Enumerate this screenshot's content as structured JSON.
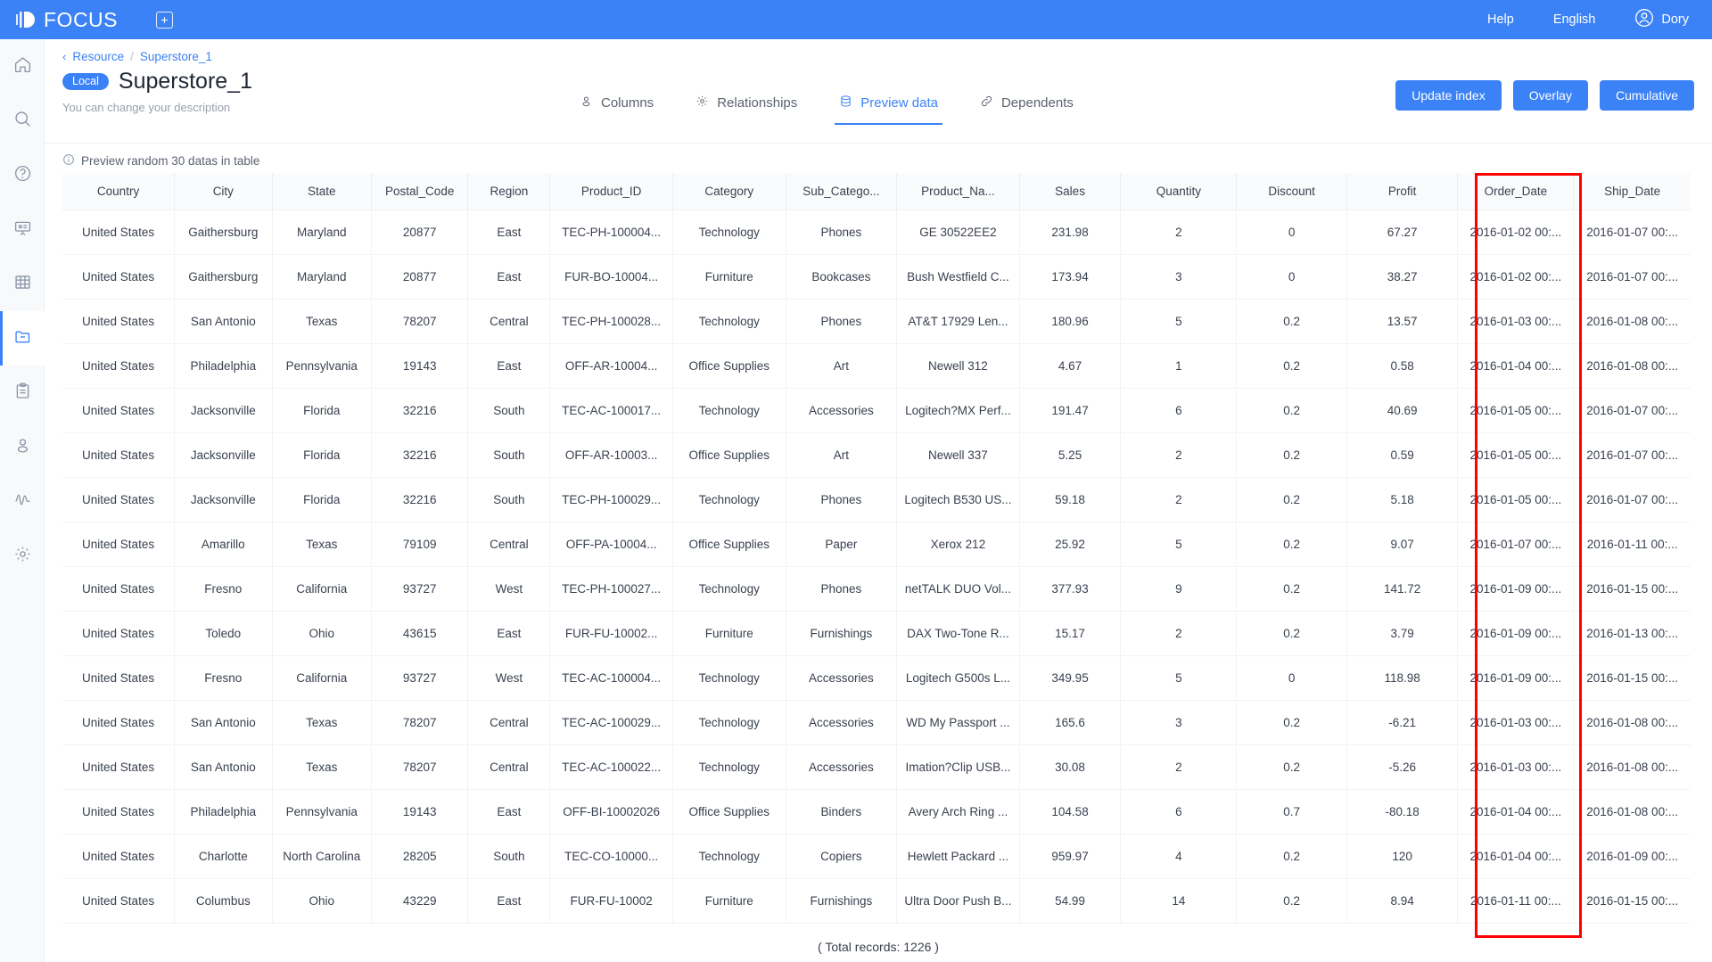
{
  "topbar": {
    "brand": "FOCUS",
    "add_icon": "plus-square-icon",
    "help": "Help",
    "language": "English",
    "user": "Dory"
  },
  "sidebar": {
    "items": [
      {
        "name": "home",
        "icon": "home-icon",
        "active": false
      },
      {
        "name": "search",
        "icon": "search-icon",
        "active": false
      },
      {
        "name": "help",
        "icon": "question-circle-icon",
        "active": false
      },
      {
        "name": "dashboard",
        "icon": "presentation-icon",
        "active": false
      },
      {
        "name": "grid",
        "icon": "table-grid-icon",
        "active": false
      },
      {
        "name": "resource",
        "icon": "folder-icon",
        "active": true
      },
      {
        "name": "reports",
        "icon": "clipboard-icon",
        "active": false
      },
      {
        "name": "users",
        "icon": "user-icon",
        "active": false
      },
      {
        "name": "monitor",
        "icon": "activity-icon",
        "active": false
      },
      {
        "name": "settings",
        "icon": "gear-icon",
        "active": false
      }
    ]
  },
  "breadcrumb": {
    "back_icon": "chevron-left-icon",
    "parent": "Resource",
    "separator": "/",
    "current": "Superstore_1"
  },
  "page_header": {
    "tag": "Local",
    "title": "Superstore_1",
    "description": "You can change your description"
  },
  "tabs": [
    {
      "label": "Columns",
      "icon": "person-icon",
      "active": false
    },
    {
      "label": "Relationships",
      "icon": "gear-icon",
      "active": false
    },
    {
      "label": "Preview data",
      "icon": "database-icon",
      "active": true
    },
    {
      "label": "Dependents",
      "icon": "link-icon",
      "active": false
    }
  ],
  "actions": [
    {
      "label": "Update index"
    },
    {
      "label": "Overlay"
    },
    {
      "label": "Cumulative"
    }
  ],
  "notice": {
    "icon": "info-circle-icon",
    "text": "Preview random 30 datas in table"
  },
  "table": {
    "columns": [
      "Country",
      "City",
      "State",
      "Postal_Code",
      "Region",
      "Product_ID",
      "Category",
      "Sub_Catego...",
      "Product_Na...",
      "Sales",
      "Quantity",
      "Discount",
      "Profit",
      "Order_Date",
      "Ship_Date"
    ],
    "highlighted_column": "Order_Date",
    "highlight_color": "#FF0000",
    "rows": [
      [
        "United States",
        "Gaithersburg",
        "Maryland",
        "20877",
        "East",
        "TEC-PH-100004...",
        "Technology",
        "Phones",
        "GE 30522EE2",
        "231.98",
        "2",
        "0",
        "67.27",
        "2016-01-02 00:...",
        "2016-01-07 00:..."
      ],
      [
        "United States",
        "Gaithersburg",
        "Maryland",
        "20877",
        "East",
        "FUR-BO-10004...",
        "Furniture",
        "Bookcases",
        "Bush Westfield C...",
        "173.94",
        "3",
        "0",
        "38.27",
        "2016-01-02 00:...",
        "2016-01-07 00:..."
      ],
      [
        "United States",
        "San Antonio",
        "Texas",
        "78207",
        "Central",
        "TEC-PH-100028...",
        "Technology",
        "Phones",
        "AT&T 17929 Len...",
        "180.96",
        "5",
        "0.2",
        "13.57",
        "2016-01-03 00:...",
        "2016-01-08 00:..."
      ],
      [
        "United States",
        "Philadelphia",
        "Pennsylvania",
        "19143",
        "East",
        "OFF-AR-10004...",
        "Office Supplies",
        "Art",
        "Newell 312",
        "4.67",
        "1",
        "0.2",
        "0.58",
        "2016-01-04 00:...",
        "2016-01-08 00:..."
      ],
      [
        "United States",
        "Jacksonville",
        "Florida",
        "32216",
        "South",
        "TEC-AC-100017...",
        "Technology",
        "Accessories",
        "Logitech?MX Perf...",
        "191.47",
        "6",
        "0.2",
        "40.69",
        "2016-01-05 00:...",
        "2016-01-07 00:..."
      ],
      [
        "United States",
        "Jacksonville",
        "Florida",
        "32216",
        "South",
        "OFF-AR-10003...",
        "Office Supplies",
        "Art",
        "Newell 337",
        "5.25",
        "2",
        "0.2",
        "0.59",
        "2016-01-05 00:...",
        "2016-01-07 00:..."
      ],
      [
        "United States",
        "Jacksonville",
        "Florida",
        "32216",
        "South",
        "TEC-PH-100029...",
        "Technology",
        "Phones",
        "Logitech B530 US...",
        "59.18",
        "2",
        "0.2",
        "5.18",
        "2016-01-05 00:...",
        "2016-01-07 00:..."
      ],
      [
        "United States",
        "Amarillo",
        "Texas",
        "79109",
        "Central",
        "OFF-PA-10004...",
        "Office Supplies",
        "Paper",
        "Xerox 212",
        "25.92",
        "5",
        "0.2",
        "9.07",
        "2016-01-07 00:...",
        "2016-01-11 00:..."
      ],
      [
        "United States",
        "Fresno",
        "California",
        "93727",
        "West",
        "TEC-PH-100027...",
        "Technology",
        "Phones",
        "netTALK DUO Vol...",
        "377.93",
        "9",
        "0.2",
        "141.72",
        "2016-01-09 00:...",
        "2016-01-15 00:..."
      ],
      [
        "United States",
        "Toledo",
        "Ohio",
        "43615",
        "East",
        "FUR-FU-10002...",
        "Furniture",
        "Furnishings",
        "DAX Two-Tone R...",
        "15.17",
        "2",
        "0.2",
        "3.79",
        "2016-01-09 00:...",
        "2016-01-13 00:..."
      ],
      [
        "United States",
        "Fresno",
        "California",
        "93727",
        "West",
        "TEC-AC-100004...",
        "Technology",
        "Accessories",
        "Logitech G500s L...",
        "349.95",
        "5",
        "0",
        "118.98",
        "2016-01-09 00:...",
        "2016-01-15 00:..."
      ],
      [
        "United States",
        "San Antonio",
        "Texas",
        "78207",
        "Central",
        "TEC-AC-100029...",
        "Technology",
        "Accessories",
        "WD My Passport ...",
        "165.6",
        "3",
        "0.2",
        "-6.21",
        "2016-01-03 00:...",
        "2016-01-08 00:..."
      ],
      [
        "United States",
        "San Antonio",
        "Texas",
        "78207",
        "Central",
        "TEC-AC-100022...",
        "Technology",
        "Accessories",
        "Imation?Clip USB...",
        "30.08",
        "2",
        "0.2",
        "-5.26",
        "2016-01-03 00:...",
        "2016-01-08 00:..."
      ],
      [
        "United States",
        "Philadelphia",
        "Pennsylvania",
        "19143",
        "East",
        "OFF-BI-10002026",
        "Office Supplies",
        "Binders",
        "Avery Arch Ring ...",
        "104.58",
        "6",
        "0.7",
        "-80.18",
        "2016-01-04 00:...",
        "2016-01-08 00:..."
      ],
      [
        "United States",
        "Charlotte",
        "North Carolina",
        "28205",
        "South",
        "TEC-CO-10000...",
        "Technology",
        "Copiers",
        "Hewlett Packard ...",
        "959.97",
        "4",
        "0.2",
        "120",
        "2016-01-04 00:...",
        "2016-01-09 00:..."
      ],
      [
        "United States",
        "Columbus",
        "Ohio",
        "43229",
        "East",
        "FUR-FU-10002",
        "Furniture",
        "Furnishings",
        "Ultra Door Push B...",
        "54.99",
        "14",
        "0.2",
        "8.94",
        "2016-01-11 00:...",
        "2016-01-15 00:..."
      ]
    ]
  },
  "footer": {
    "total_records": "( Total records: 1226 )"
  },
  "colors": {
    "accent": "#3B82F6",
    "highlight": "#FF0000",
    "text": "#39414F"
  }
}
